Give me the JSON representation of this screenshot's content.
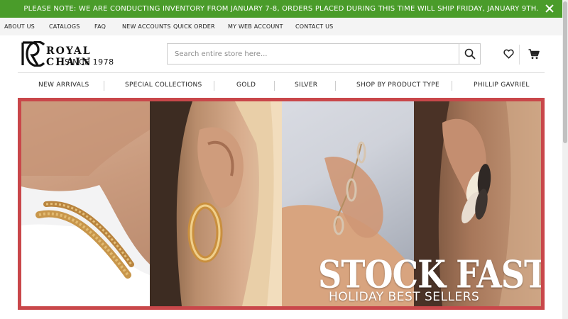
{
  "notice": {
    "text": "PLEASE NOTE: WE ARE CONDUCTING INVENTORY FROM JANUARY 7-8, ORDERS PLACED DURING THIS TIME WILL SHIP FRIDAY, JANUARY 9TH.",
    "close_icon": "close-icon",
    "bg_color": "#4a9c2a"
  },
  "toplinks": [
    {
      "label": "ABOUT US"
    },
    {
      "label": "CATALOGS"
    },
    {
      "label": "FAQ"
    },
    {
      "label": "NEW ACCOUNTS"
    },
    {
      "label": "QUICK ORDER"
    },
    {
      "label": "MY WEB ACCOUNT"
    },
    {
      "label": "CONTACT US"
    }
  ],
  "logo": {
    "name": "ROYAL CHAIN",
    "since": "SINCE 1978",
    "mark_letters": "RC"
  },
  "search": {
    "placeholder": "Search entire store here...",
    "value": "",
    "icon": "search-icon"
  },
  "header_icons": {
    "wishlist": "heart-icon",
    "cart": "cart-icon"
  },
  "nav": {
    "items": [
      {
        "label": "NEW ARRIVALS"
      },
      {
        "label": "SPECIAL COLLECTIONS"
      },
      {
        "label": "GOLD"
      },
      {
        "label": "SILVER"
      },
      {
        "label": "SHOP BY PRODUCT TYPE"
      },
      {
        "label": "PHILLIP GAVRIEL"
      }
    ]
  },
  "hero": {
    "headline": "STOCK FAST!",
    "subheadline": "HOLIDAY BEST SELLERS",
    "frame_color": "#c9474a"
  }
}
